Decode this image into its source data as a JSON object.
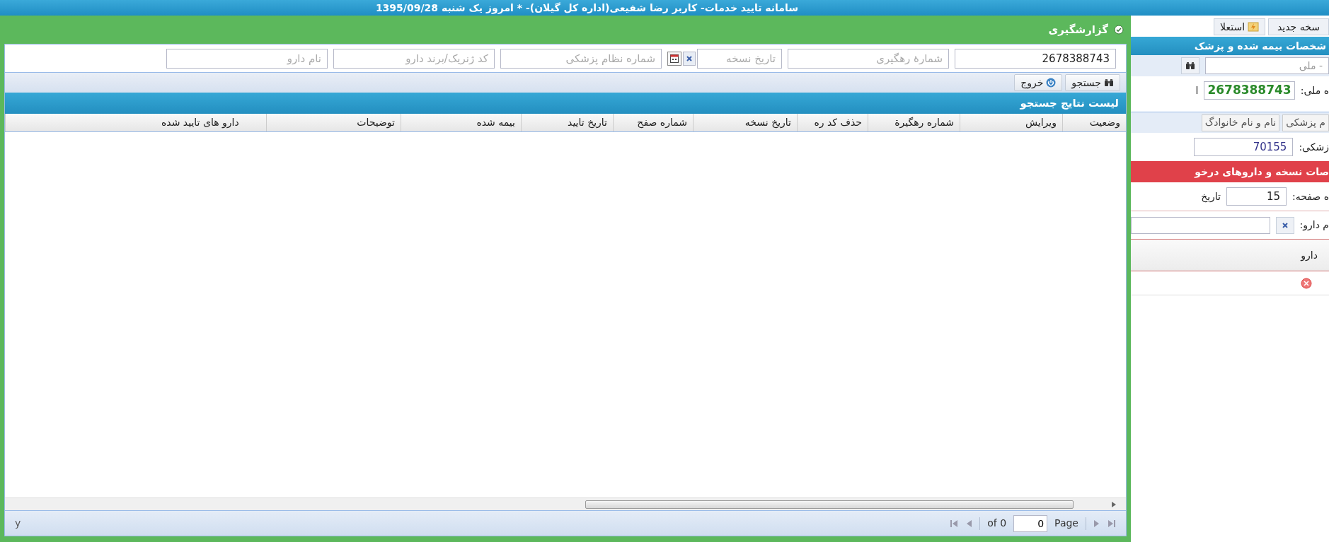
{
  "app_title": "سامانه تایید خدمات- کاربر رضا شفیعی(اداره کل گیلان)- * امروز یک شنبه 1395/09/28",
  "dialog": {
    "title": "گزارشگیری",
    "filters": [
      {
        "kind": "text",
        "value": "2678388743"
      },
      {
        "kind": "text",
        "placeholder": "شمارهٔ رهگیری"
      },
      {
        "kind": "date",
        "placeholder": "تاریخ نسخه"
      },
      {
        "kind": "text",
        "placeholder": "شماره نظام پزشکی"
      },
      {
        "kind": "text",
        "placeholder": "کد ژنریک/برند دارو"
      },
      {
        "kind": "text",
        "placeholder": "نام دارو"
      }
    ],
    "buttons": [
      {
        "kind": "search",
        "label": "جستجو"
      },
      {
        "kind": "exit",
        "label": "خروج"
      }
    ],
    "results_title": "لیست نتایج جستجو",
    "columns": [
      "وضعیت",
      "ویرایش",
      "شماره رهگیرة",
      "حذف کد ره",
      "تاریخ نسخه",
      "شماره صفح",
      "تاریخ تایید",
      "بیمه شده",
      "توضیحات",
      "دارو های تایید شده"
    ],
    "pager": {
      "page_label": "Page",
      "page_value": "0",
      "of": "of 0",
      "info": "y"
    }
  },
  "background": {
    "tabs": [
      "سخه جدید",
      "استعلا"
    ],
    "insured_header": "شخصات بیمه شده و پزشک",
    "national_placeholder": "- ملی",
    "national_label": "ه ملی:",
    "national_value": "2678388743",
    "cut_label": "ا",
    "sub_tabs": [
      "م پزشکی",
      "نام و نام خانوادگ"
    ],
    "doctor_label": "زشکی:",
    "doctor_value": "70155",
    "rx_header": "صات نسخه و داروهای درخو",
    "page_label": "ه صفحه:",
    "page_value": "15",
    "date_label": "تاریخ",
    "drug_label": "م دارو:",
    "grid_column": "دارو"
  }
}
